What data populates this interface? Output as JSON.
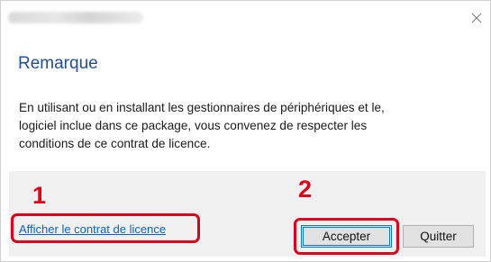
{
  "dialog": {
    "title_bar": {
      "title_text_blurred": true,
      "close_icon": "close-icon"
    },
    "heading": "Remarque",
    "message": "En utilisant ou en installant les gestionnaires de périphériques et le, logiciel inclue dans ce package, vous convenez de respecter les conditions de ce contrat de licence.",
    "message_lines": [
      "En utilisant ou en installant les gestionnaires de périphériques et le,",
      "logiciel inclue dans ce package, vous convenez de respecter les",
      "conditions de ce contrat de licence."
    ],
    "license_link": "Afficher le contrat de licence",
    "buttons": {
      "accept": "Accepter",
      "quit": "Quitter"
    }
  },
  "annotations": {
    "step_1": "1",
    "step_2": "2",
    "highlight_color": "#e2001a"
  },
  "colors": {
    "heading": "#1f4e9a",
    "link": "#0b62c8",
    "footer_background": "#f0f0f0",
    "focus_border": "#0a78d7"
  }
}
